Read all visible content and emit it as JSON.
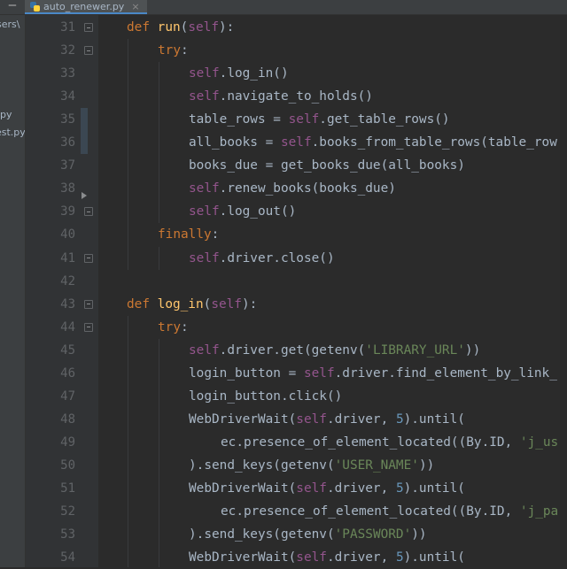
{
  "tab": {
    "minimize": "—",
    "filename": "auto_renewer.py",
    "close": "×"
  },
  "project_panel": [
    {
      "text": "sers\\"
    },
    {
      "text": "py"
    },
    {
      "text": "est.py"
    }
  ],
  "code": {
    "lines": [
      {
        "number": "31",
        "indent": 1,
        "tokens": [
          {
            "t": "def ",
            "c": "kw"
          },
          {
            "t": "run",
            "c": "fn"
          },
          {
            "t": "(",
            "c": "plain"
          },
          {
            "t": "self",
            "c": "slf"
          },
          {
            "t": "):",
            "c": "plain"
          }
        ]
      },
      {
        "number": "32",
        "indent": 2,
        "tokens": [
          {
            "t": "try",
            "c": "kw"
          },
          {
            "t": ":",
            "c": "plain"
          }
        ]
      },
      {
        "number": "33",
        "indent": 3,
        "tokens": [
          {
            "t": "self",
            "c": "slf"
          },
          {
            "t": ".log_in()",
            "c": "plain"
          }
        ]
      },
      {
        "number": "34",
        "indent": 3,
        "tokens": [
          {
            "t": "self",
            "c": "slf"
          },
          {
            "t": ".navigate_to_holds()",
            "c": "plain"
          }
        ]
      },
      {
        "number": "35",
        "indent": 3,
        "tokens": [
          {
            "t": "table_rows = ",
            "c": "plain"
          },
          {
            "t": "self",
            "c": "slf"
          },
          {
            "t": ".get_table_rows()",
            "c": "plain"
          }
        ]
      },
      {
        "number": "36",
        "indent": 3,
        "tokens": [
          {
            "t": "all_books = ",
            "c": "plain"
          },
          {
            "t": "self",
            "c": "slf"
          },
          {
            "t": ".books_from_table_rows(table_row",
            "c": "plain"
          }
        ]
      },
      {
        "number": "37",
        "indent": 3,
        "tokens": [
          {
            "t": "books_due = get_books_due(all_books)",
            "c": "plain"
          }
        ]
      },
      {
        "number": "38",
        "indent": 3,
        "tokens": [
          {
            "t": "self",
            "c": "slf"
          },
          {
            "t": ".renew_books(books_due)",
            "c": "plain"
          }
        ]
      },
      {
        "number": "39",
        "indent": 3,
        "tokens": [
          {
            "t": "self",
            "c": "slf"
          },
          {
            "t": ".log_out()",
            "c": "plain"
          }
        ]
      },
      {
        "number": "40",
        "indent": 2,
        "tokens": [
          {
            "t": "finally",
            "c": "kw"
          },
          {
            "t": ":",
            "c": "plain"
          }
        ]
      },
      {
        "number": "41",
        "indent": 3,
        "tokens": [
          {
            "t": "self",
            "c": "slf"
          },
          {
            "t": ".driver.close()",
            "c": "plain"
          }
        ]
      },
      {
        "number": "42",
        "indent": 0,
        "tokens": []
      },
      {
        "number": "43",
        "indent": 1,
        "tokens": [
          {
            "t": "def ",
            "c": "kw"
          },
          {
            "t": "log_in",
            "c": "fn"
          },
          {
            "t": "(",
            "c": "plain"
          },
          {
            "t": "self",
            "c": "slf"
          },
          {
            "t": "):",
            "c": "plain"
          }
        ]
      },
      {
        "number": "44",
        "indent": 2,
        "tokens": [
          {
            "t": "try",
            "c": "kw"
          },
          {
            "t": ":",
            "c": "plain"
          }
        ]
      },
      {
        "number": "45",
        "indent": 3,
        "tokens": [
          {
            "t": "self",
            "c": "slf"
          },
          {
            "t": ".driver.get(getenv(",
            "c": "plain"
          },
          {
            "t": "'LIBRARY_URL'",
            "c": "str"
          },
          {
            "t": "))",
            "c": "plain"
          }
        ]
      },
      {
        "number": "46",
        "indent": 3,
        "tokens": [
          {
            "t": "login_button = ",
            "c": "plain"
          },
          {
            "t": "self",
            "c": "slf"
          },
          {
            "t": ".driver.find_element_by_link_",
            "c": "plain"
          }
        ]
      },
      {
        "number": "47",
        "indent": 3,
        "tokens": [
          {
            "t": "login_button.click()",
            "c": "plain"
          }
        ]
      },
      {
        "number": "48",
        "indent": 3,
        "tokens": [
          {
            "t": "WebDriverWait(",
            "c": "plain"
          },
          {
            "t": "self",
            "c": "slf"
          },
          {
            "t": ".driver, ",
            "c": "plain"
          },
          {
            "t": "5",
            "c": "num"
          },
          {
            "t": ").until(",
            "c": "plain"
          }
        ]
      },
      {
        "number": "49",
        "indent": 4,
        "tokens": [
          {
            "t": "ec.presence_of_element_located((By.ID, ",
            "c": "plain"
          },
          {
            "t": "'j_us",
            "c": "str"
          }
        ]
      },
      {
        "number": "50",
        "indent": 3,
        "tokens": [
          {
            "t": ").send_keys(getenv(",
            "c": "plain"
          },
          {
            "t": "'USER_NAME'",
            "c": "str"
          },
          {
            "t": "))",
            "c": "plain"
          }
        ]
      },
      {
        "number": "51",
        "indent": 3,
        "tokens": [
          {
            "t": "WebDriverWait(",
            "c": "plain"
          },
          {
            "t": "self",
            "c": "slf"
          },
          {
            "t": ".driver, ",
            "c": "plain"
          },
          {
            "t": "5",
            "c": "num"
          },
          {
            "t": ").until(",
            "c": "plain"
          }
        ]
      },
      {
        "number": "52",
        "indent": 4,
        "tokens": [
          {
            "t": "ec.presence_of_element_located((By.ID, ",
            "c": "plain"
          },
          {
            "t": "'j_pa",
            "c": "str"
          }
        ]
      },
      {
        "number": "53",
        "indent": 3,
        "tokens": [
          {
            "t": ").send_keys(getenv(",
            "c": "plain"
          },
          {
            "t": "'PASSWORD'",
            "c": "str"
          },
          {
            "t": "))",
            "c": "plain"
          }
        ]
      },
      {
        "number": "54",
        "indent": 3,
        "tokens": [
          {
            "t": "WebDriverWait(",
            "c": "plain"
          },
          {
            "t": "self",
            "c": "slf"
          },
          {
            "t": ".driver, ",
            "c": "plain"
          },
          {
            "t": "5",
            "c": "num"
          },
          {
            "t": ").until(",
            "c": "plain"
          }
        ]
      }
    ]
  },
  "colors": {
    "background": "#2b2b2b",
    "gutter": "#313335",
    "keyword": "#cc7832",
    "function": "#ffc66d",
    "self": "#94558d",
    "string": "#6a8759",
    "number": "#6897bb",
    "text": "#a9b7c6"
  }
}
